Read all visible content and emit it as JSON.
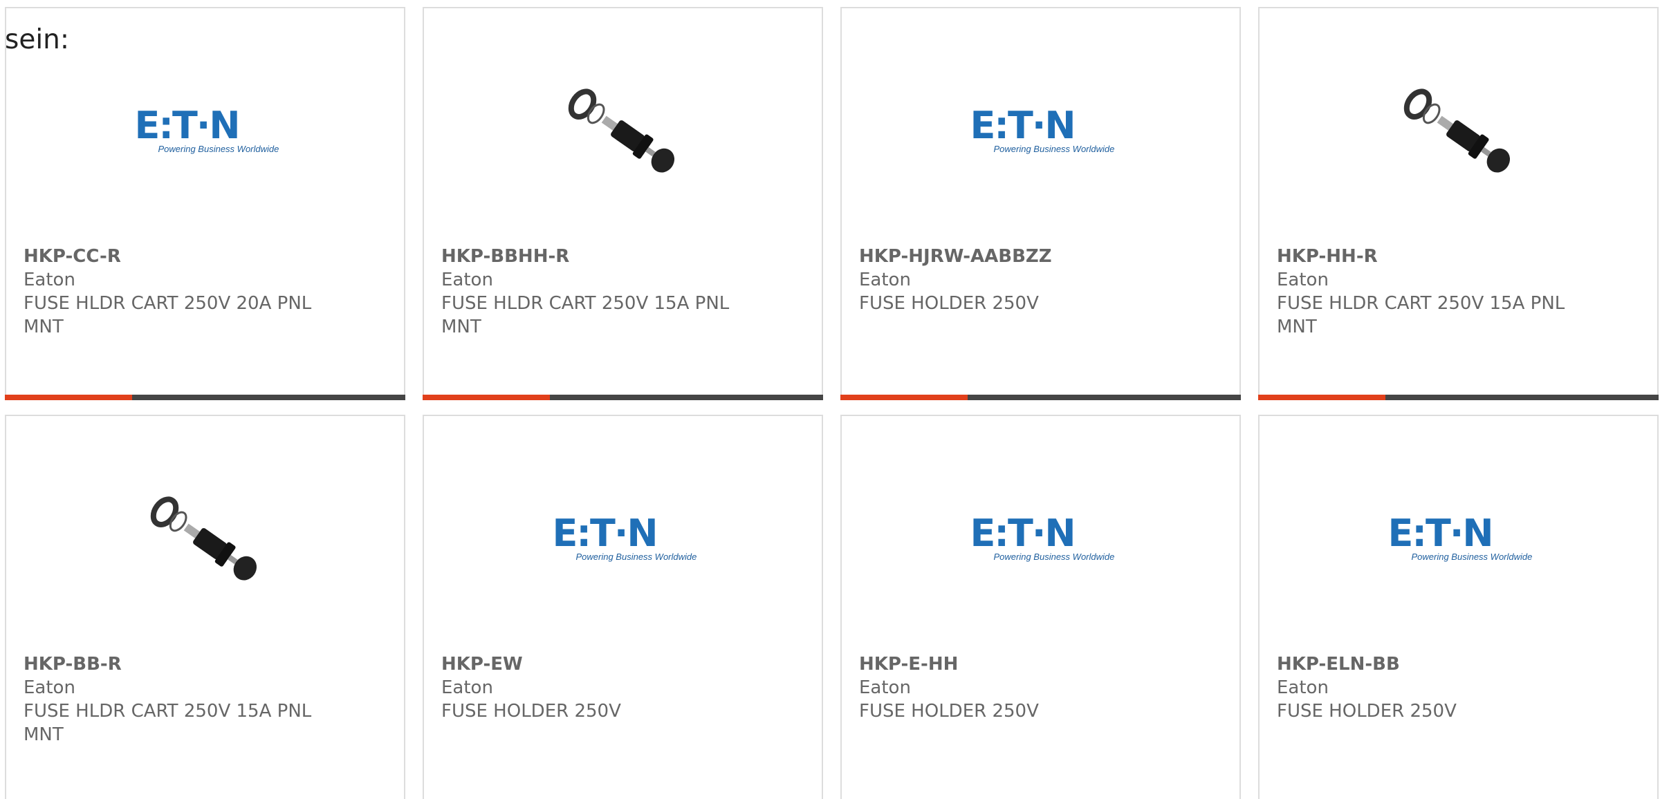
{
  "intro_text": "sein:",
  "colors": {
    "accent": "#e1401b",
    "bar": "#454545",
    "border": "#dddddd",
    "text": "#666666",
    "eaton_blue": "#1f6fb7"
  },
  "logo": {
    "word": "E:T·N",
    "tagline": "Powering Business Worldwide"
  },
  "products": [
    {
      "part_number": "HKP-CC-R",
      "manufacturer": "Eaton",
      "description": "FUSE HLDR CART 250V 20A PNL MNT",
      "image": "eaton-logo"
    },
    {
      "part_number": "HKP-BBHH-R",
      "manufacturer": "Eaton",
      "description": "FUSE HLDR CART 250V 15A PNL MNT",
      "image": "fuse-holder-photo"
    },
    {
      "part_number": "HKP-HJRW-AABBZZ",
      "manufacturer": "Eaton",
      "description": "FUSE HOLDER 250V",
      "image": "eaton-logo"
    },
    {
      "part_number": "HKP-HH-R",
      "manufacturer": "Eaton",
      "description": "FUSE HLDR CART 250V 15A PNL MNT",
      "image": "fuse-holder-photo"
    },
    {
      "part_number": "HKP-BB-R",
      "manufacturer": "Eaton",
      "description": "FUSE HLDR CART 250V 15A PNL MNT",
      "image": "fuse-holder-photo"
    },
    {
      "part_number": "HKP-EW",
      "manufacturer": "Eaton",
      "description": "FUSE HOLDER 250V",
      "image": "eaton-logo"
    },
    {
      "part_number": "HKP-E-HH",
      "manufacturer": "Eaton",
      "description": "FUSE HOLDER 250V",
      "image": "eaton-logo"
    },
    {
      "part_number": "HKP-ELN-BB",
      "manufacturer": "Eaton",
      "description": "FUSE HOLDER 250V",
      "image": "eaton-logo"
    }
  ]
}
